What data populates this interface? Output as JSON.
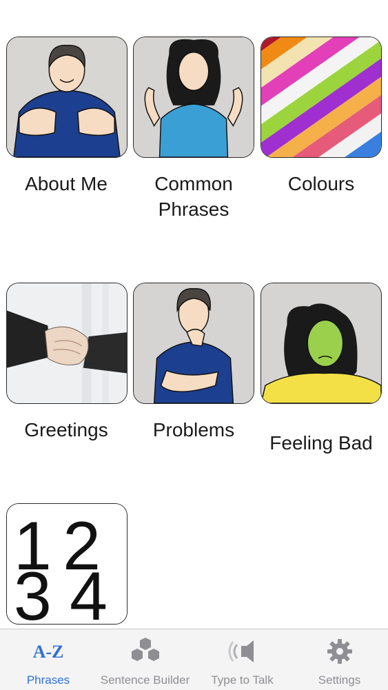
{
  "categories": [
    {
      "id": "about-me",
      "label": "About Me"
    },
    {
      "id": "common-phrases",
      "label": "Common Phrases"
    },
    {
      "id": "colours",
      "label": "Colours"
    },
    {
      "id": "greetings",
      "label": "Greetings"
    },
    {
      "id": "problems",
      "label": "Problems"
    },
    {
      "id": "feeling-bad",
      "label": "Feeling Bad"
    },
    {
      "id": "numbers",
      "label": ""
    }
  ],
  "numbers_tile": {
    "glyphs": [
      "1",
      "2",
      "3",
      "4"
    ]
  },
  "tabbar": {
    "active": "phrases",
    "tabs": [
      {
        "id": "phrases",
        "label": "Phrases",
        "icon": "az-icon",
        "glyph": "A-Z"
      },
      {
        "id": "sentence-builder",
        "label": "Sentence Builder",
        "icon": "blocks-icon"
      },
      {
        "id": "type-to-talk",
        "label": "Type to Talk",
        "icon": "speaker-icon"
      },
      {
        "id": "settings",
        "label": "Settings",
        "icon": "gear-icon"
      }
    ]
  },
  "colors": {
    "accent": "#2f6fd6",
    "inactive": "#8e8e93",
    "tabbar_bg": "#f4f4f5"
  }
}
